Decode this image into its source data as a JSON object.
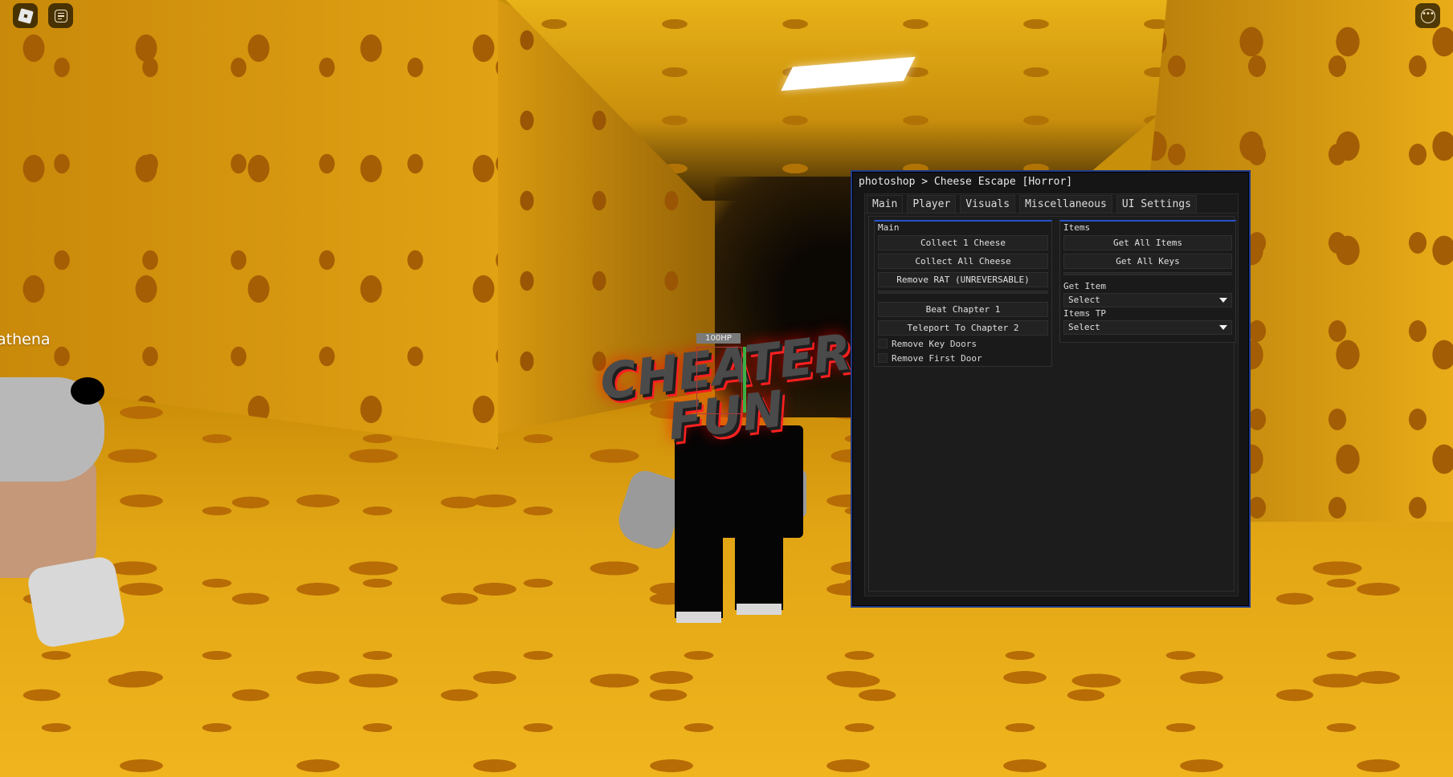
{
  "hud": {
    "roblox_menu_icon": "roblox-logo-icon",
    "chat_icon": "chat-icon",
    "more_icon": "more-options-icon",
    "more_glyph": "•••"
  },
  "scene": {
    "other_player_name": "athena",
    "logo_line1": "CHEATER",
    "logo_line2": "FUN",
    "esp_health_label": "100HP",
    "esp_health_fraction": 1.0
  },
  "menu": {
    "title": "photoshop > Cheese Escape [Horror]",
    "tabs": [
      {
        "label": "Main",
        "active": true
      },
      {
        "label": "Player",
        "active": false
      },
      {
        "label": "Visuals",
        "active": false
      },
      {
        "label": "Miscellaneous",
        "active": false
      },
      {
        "label": "UI Settings",
        "active": false
      }
    ],
    "main_section": {
      "title": "Main",
      "buttons": [
        "Collect 1 Cheese",
        "Collect All Cheese",
        "Remove RAT (UNREVERSABLE)",
        "Beat Chapter 1",
        "Teleport To Chapter 2"
      ],
      "toggles": [
        {
          "label": "Remove Key Doors",
          "checked": false
        },
        {
          "label": "Remove First Door",
          "checked": false
        }
      ]
    },
    "items_section": {
      "title": "Items",
      "buttons": [
        "Get All Items",
        "Get All Keys"
      ],
      "dropdowns": [
        {
          "label": "Get Item",
          "value": "Select"
        },
        {
          "label": "Items TP",
          "value": "Select"
        }
      ]
    }
  },
  "colors": {
    "accent": "#2553c7",
    "window_border": "#1f3a8a",
    "esp_box": "#b03a3a",
    "esp_health": "#3cb043"
  }
}
